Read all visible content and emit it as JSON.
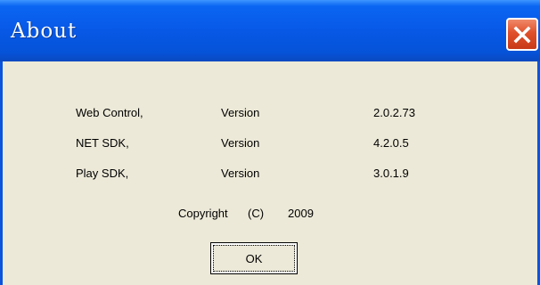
{
  "window": {
    "title": "About"
  },
  "rows": [
    {
      "name": "Web Control,",
      "label": "Version",
      "version": "2.0.2.73"
    },
    {
      "name": "NET SDK,",
      "label": "Version",
      "version": "4.2.0.5"
    },
    {
      "name": "Play SDK,",
      "label": "Version",
      "version": "3.0.1.9"
    }
  ],
  "copyright": {
    "word": "Copyright",
    "symbol": "(C)",
    "year": "2009"
  },
  "buttons": {
    "ok": "OK"
  },
  "icons": {
    "close": "close-icon"
  },
  "colors": {
    "titlebar": "#0858e6",
    "close": "#e0502a",
    "face": "#ece9d8"
  }
}
